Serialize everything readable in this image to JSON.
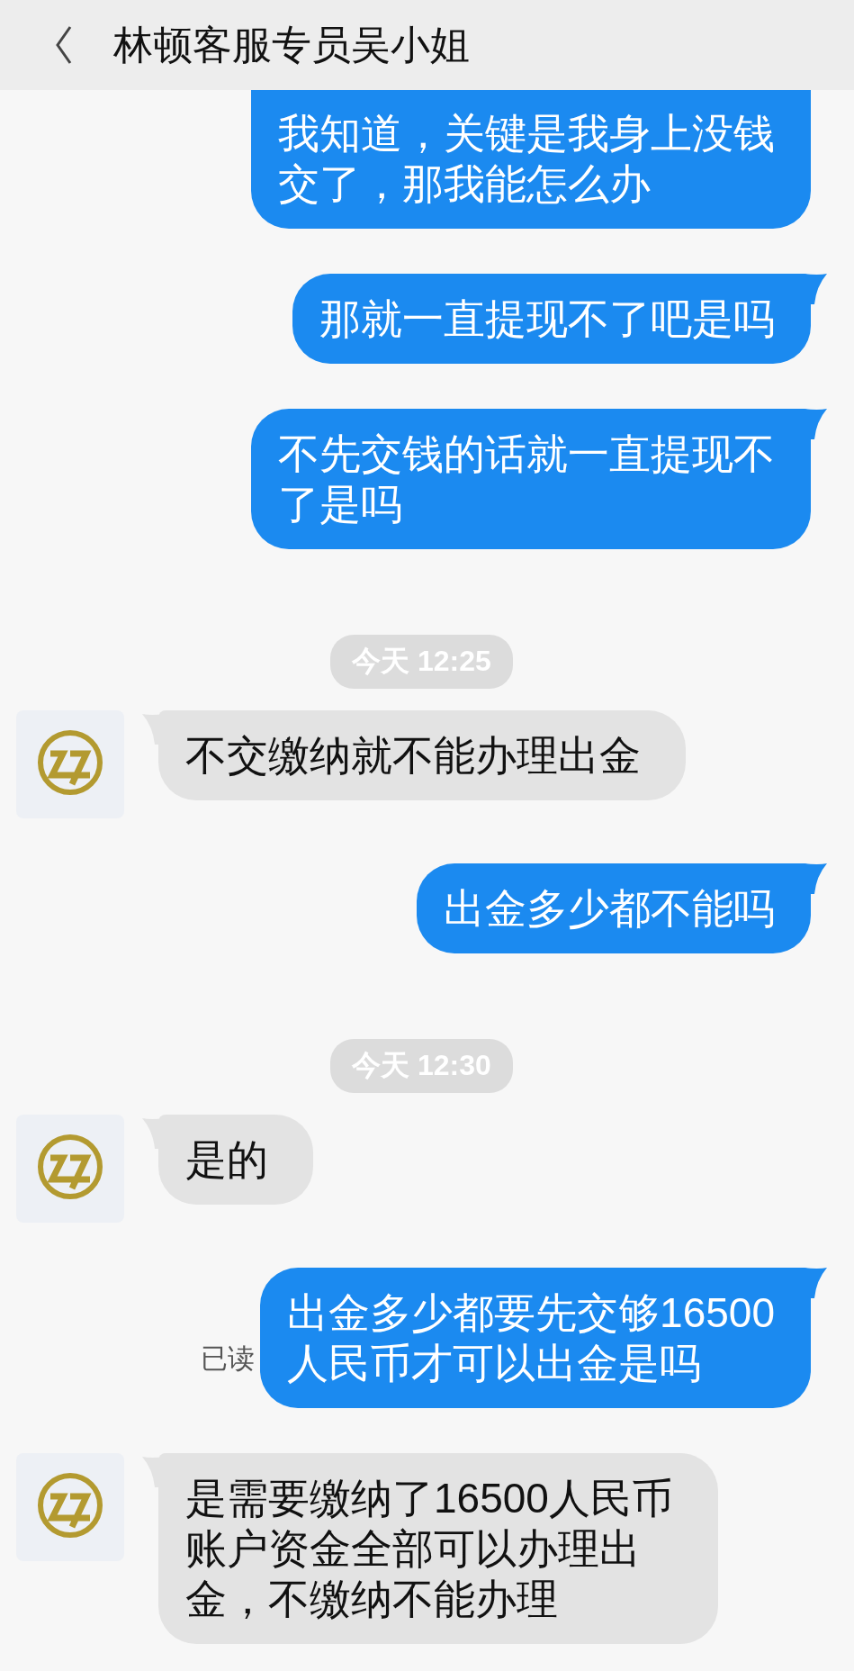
{
  "header": {
    "title": "林顿客服专员吴小姐"
  },
  "messages": [
    {
      "kind": "sent",
      "lines": [
        "我知道，关键是我身上没钱",
        "交了，那我能怎么办"
      ],
      "cut_top": true
    },
    {
      "kind": "sent",
      "lines": [
        "那就一直提现不了吧是吗"
      ]
    },
    {
      "kind": "sent",
      "lines": [
        "不先交钱的话就一直提现不",
        "了是吗"
      ]
    },
    {
      "kind": "time",
      "text": "今天 12:25"
    },
    {
      "kind": "received",
      "lines": [
        "不交缴纳就不能办理出金"
      ]
    },
    {
      "kind": "sent",
      "lines": [
        "出金多少都不能吗"
      ]
    },
    {
      "kind": "time",
      "text": "今天 12:30"
    },
    {
      "kind": "received",
      "lines": [
        "是的"
      ]
    },
    {
      "kind": "sent",
      "lines": [
        "出金多少都要先交够16500",
        "人民币才可以出金是吗"
      ],
      "read_label": "已读"
    },
    {
      "kind": "received",
      "lines": [
        "是需要缴纳了16500人民币",
        "账户资金全部可以办理出",
        "金，不缴纳不能办理"
      ]
    }
  ]
}
